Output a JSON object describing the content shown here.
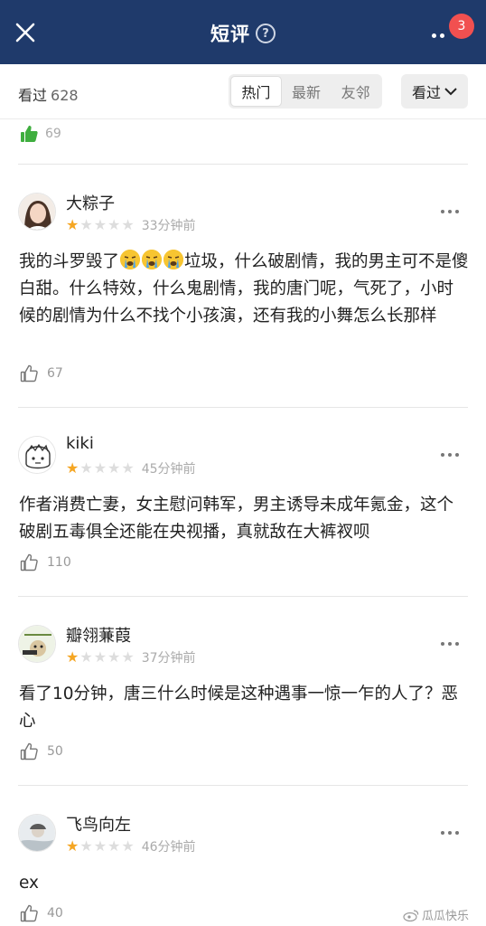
{
  "header": {
    "title": "短评",
    "help_symbol": "?",
    "notification_count": "3",
    "colors": {
      "bar": "#1f3a6b",
      "badge": "#f15050"
    }
  },
  "filter": {
    "seen_label": "看过",
    "seen_count": "628",
    "tabs": [
      "热门",
      "最新",
      "友邻"
    ],
    "active_tab": "热门",
    "dropdown_label": "看过"
  },
  "previous": {
    "likes": "69"
  },
  "comments": [
    {
      "user": "大粽子",
      "rating": 1,
      "time": "33分钟前",
      "text_parts": [
        "我的斗罗毁了",
        "垃圾，什么破剧情，我的男主可不是傻白甜。什么特效，什么鬼剧情，我的唐门呢，气死了，小时候的剧情为什么不找个小孩演，还有我的小舞怎么长那样"
      ],
      "emoji": "crying-face-emoji",
      "likes": "67"
    },
    {
      "user": "kiki",
      "rating": 1,
      "time": "45分钟前",
      "text": "作者消费亡妻，女主慰问韩军，男主诱导未成年氪金，这个破剧五毒俱全还能在央视播，真就敌在大裤衩呗",
      "likes": "110"
    },
    {
      "user": "瓣翎蒹葭",
      "rating": 1,
      "time": "37分钟前",
      "text": "看了10分钟，唐三什么时候是这种遇事一惊一乍的人了？恶心",
      "likes": "50"
    },
    {
      "user": "飞鸟向左",
      "rating": 1,
      "time": "46分钟前",
      "text": "ex",
      "likes": "40"
    }
  ],
  "watermark": "瓜瓜快乐",
  "star_color": "#f5a623"
}
